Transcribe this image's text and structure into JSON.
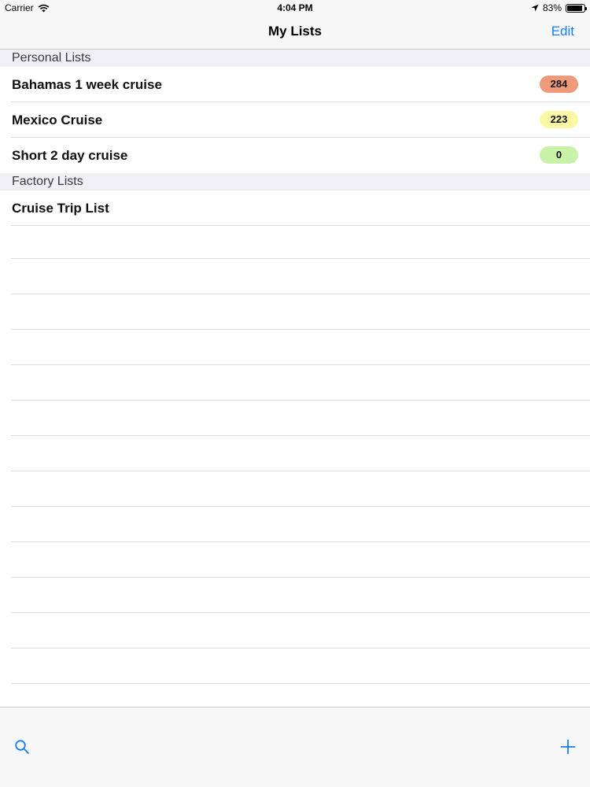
{
  "status_bar": {
    "carrier": "Carrier",
    "time": "4:04 PM",
    "battery": "83%",
    "battery_level": 0.83,
    "icons": [
      "wifi-icon",
      "location-arrow-icon",
      "battery-icon"
    ]
  },
  "nav": {
    "title": "My Lists",
    "edit_label": "Edit"
  },
  "sections": [
    {
      "header": "Personal Lists",
      "rows": [
        {
          "label": "Bahamas 1 week cruise",
          "count": "284",
          "badge_color": "#ef9a7a"
        },
        {
          "label": "Mexico Cruise",
          "count": "223",
          "badge_color": "#fbf8a6"
        },
        {
          "label": "Short 2 day cruise",
          "count": "0",
          "badge_color": "#c8f2a8"
        }
      ]
    },
    {
      "header": "Factory Lists",
      "rows": [
        {
          "label": "Cruise Trip List"
        }
      ]
    }
  ],
  "toolbar": {
    "icons": [
      "search-icon",
      "add-icon"
    ]
  },
  "colors": {
    "tint": "#157efb",
    "header_bg": "#efeff4",
    "bar_bg": "#f7f7f7"
  }
}
